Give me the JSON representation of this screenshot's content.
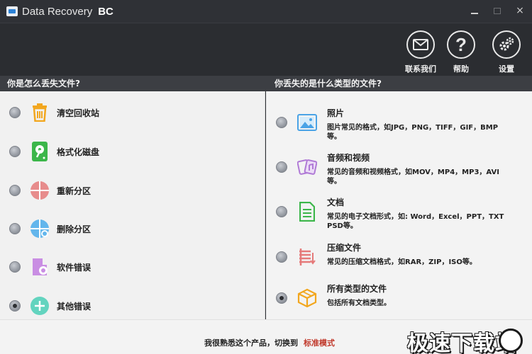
{
  "window": {
    "title": "Data Recovery",
    "title_badge": "BC",
    "controls": {
      "minimize": "",
      "maximize": "",
      "close": "×"
    }
  },
  "toolbar": {
    "contact_label": "联系我们",
    "help_label": "帮助",
    "settings_label": "设置",
    "contact_icon": "envelope-icon",
    "help_icon": "question-icon",
    "settings_icon": "gear-icon"
  },
  "left_section": {
    "header": "你是怎么丢失文件?",
    "options": [
      {
        "label": "清空回收站",
        "icon": "recycle-bin-icon",
        "color": "#f2a71f",
        "checked": false
      },
      {
        "label": "格式化磁盘",
        "icon": "disk-icon",
        "color": "#3cb64a",
        "checked": false
      },
      {
        "label": "重新分区",
        "icon": "partition-icon",
        "color": "#e78c8c",
        "checked": false
      },
      {
        "label": "删除分区",
        "icon": "delete-partition-icon",
        "color": "#63b6ec",
        "checked": false
      },
      {
        "label": "软件错误",
        "icon": "software-error-icon",
        "color": "#c98ee3",
        "checked": false
      },
      {
        "label": "其他错误",
        "icon": "other-error-icon",
        "color": "#63d4bf",
        "checked": true
      }
    ]
  },
  "right_section": {
    "header": "你丢失的是什么类型的文件?",
    "options": [
      {
        "title": "照片",
        "desc": "图片常见的格式，如JPG，PNG，TIFF，GIF，BMP等。",
        "icon": "photo-icon",
        "color": "#4aa3e6",
        "checked": false
      },
      {
        "title": "音频和视频",
        "desc": "常见的音频和视频格式，如MOV，MP4，MP3，AVI等。",
        "icon": "audio-video-icon",
        "color": "#b07ad6",
        "checked": false
      },
      {
        "title": "文档",
        "desc": "常见的电子文档形式，如: Word，Excel，PPT，TXT PSD等。",
        "icon": "document-icon",
        "color": "#3cb64a",
        "checked": false
      },
      {
        "title": "压缩文件",
        "desc": "常见的压缩文档格式，如RAR，ZIP，ISO等。",
        "icon": "archive-icon",
        "color": "#e57a7a",
        "checked": false
      },
      {
        "title": "所有类型的文件",
        "desc": "包括所有文档类型。",
        "icon": "box-icon",
        "color": "#f2a71f",
        "checked": true
      }
    ]
  },
  "footer": {
    "text": "我很熟悉这个产品，切换到",
    "link": "标准模式",
    "link_color": "#c0392b",
    "watermark": "极速下载站"
  }
}
